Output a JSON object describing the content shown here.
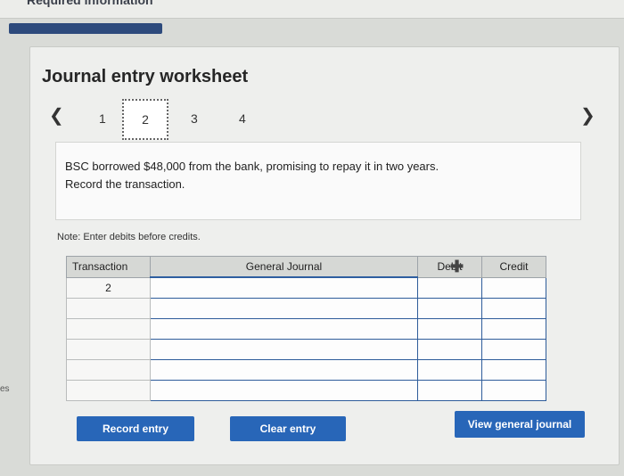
{
  "header": {
    "title": "Required information"
  },
  "side": {
    "label": "es"
  },
  "worksheet": {
    "title": "Journal entry worksheet",
    "steps": [
      "1",
      "2",
      "3",
      "4"
    ],
    "active_step": "2",
    "description_line1": "BSC borrowed $48,000 from the bank, promising to repay it in two years.",
    "description_line2": "Record the transaction.",
    "note": "Note: Enter debits before credits.",
    "table": {
      "columns": [
        "Transaction",
        "General Journal",
        "Debit",
        "Credit"
      ],
      "rows": [
        {
          "transaction": "2",
          "general_journal": "",
          "debit": "",
          "credit": ""
        },
        {
          "transaction": "",
          "general_journal": "",
          "debit": "",
          "credit": ""
        },
        {
          "transaction": "",
          "general_journal": "",
          "debit": "",
          "credit": ""
        },
        {
          "transaction": "",
          "general_journal": "",
          "debit": "",
          "credit": ""
        },
        {
          "transaction": "",
          "general_journal": "",
          "debit": "",
          "credit": ""
        },
        {
          "transaction": "",
          "general_journal": "",
          "debit": "",
          "credit": ""
        }
      ]
    },
    "buttons": {
      "record": "Record entry",
      "clear": "Clear entry",
      "view": "View general journal"
    }
  },
  "icons": {
    "prev": "chevron-left-icon",
    "next": "chevron-right-icon",
    "add": "plus-icon"
  },
  "colors": {
    "accent": "#2866b8",
    "bar": "#2d4a7c"
  }
}
